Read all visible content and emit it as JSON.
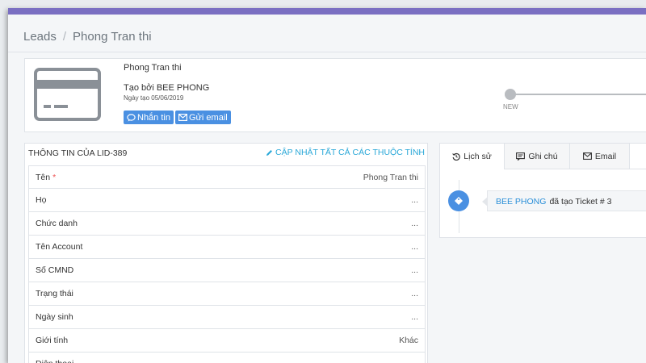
{
  "breadcrumb": {
    "root": "Leads",
    "separator": "/",
    "current": "Phong Tran thi"
  },
  "colors": {
    "top_bar": "#7a6fc2",
    "accent_blue": "#4a90e2",
    "link_blue": "#2aa8d8",
    "required_red": "#e55555"
  },
  "profile": {
    "name": "Phong Tran thi",
    "created_by": "Tạo bởi BEE PHONG",
    "created_date": "Ngày tạo 05/06/2019",
    "icon": "credit-card-icon",
    "buttons": {
      "message": "Nhắn tin",
      "email": "Gửi email"
    }
  },
  "pipeline": {
    "stage": "NEW"
  },
  "info_panel": {
    "title": "THÔNG TIN CỦA LID-389",
    "update_all": "CẬP NHẬT TẤT CẢ CÁC THUỘC TÍNH",
    "rows": [
      {
        "label": "Tên",
        "required": "*",
        "value": "Phong Tran thi"
      },
      {
        "label": "Họ",
        "required": "",
        "value": "..."
      },
      {
        "label": "Chức danh",
        "required": "",
        "value": "..."
      },
      {
        "label": "Tên Account",
        "required": "",
        "value": "..."
      },
      {
        "label": "Số CMND",
        "required": "",
        "value": "..."
      },
      {
        "label": "Trạng thái",
        "required": "",
        "value": "..."
      },
      {
        "label": "Ngày sinh",
        "required": "",
        "value": "..."
      },
      {
        "label": "Giới tính",
        "required": "",
        "value": "Khác"
      },
      {
        "label": "Điện thoại",
        "required": "",
        "value": ""
      }
    ]
  },
  "activity": {
    "tabs": [
      {
        "label": "Lịch sử",
        "icon": "history-icon"
      },
      {
        "label": "Ghi chú",
        "icon": "note-icon"
      },
      {
        "label": "Email",
        "icon": "envelope-icon"
      }
    ],
    "entries": [
      {
        "actor": "BEE PHONG",
        "text": "đã tạo Ticket # 3",
        "icon": "ticket-icon"
      }
    ]
  }
}
